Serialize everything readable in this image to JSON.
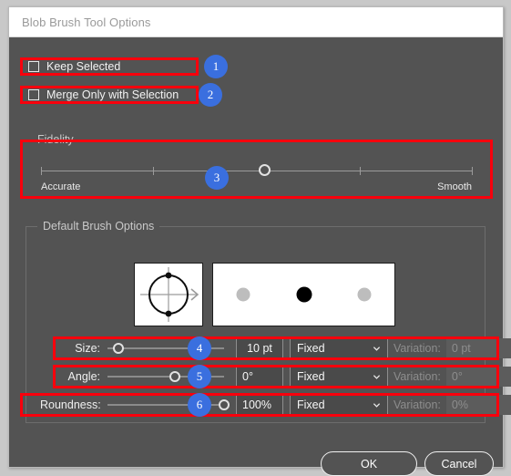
{
  "window": {
    "title": "Blob Brush Tool Options",
    "accent_blue": "#3a6fdf",
    "annotation_red": "#f8000c",
    "body_bg": "#535353",
    "titlebar_bg": "#ffffff"
  },
  "checkboxes": [
    {
      "label": "Keep Selected",
      "checked": false,
      "badge": "1"
    },
    {
      "label": "Merge Only with Selection",
      "checked": false,
      "badge": "2"
    }
  ],
  "fidelity": {
    "title": "Fidelity",
    "left_label": "Accurate",
    "right_label": "Smooth",
    "badge": "3",
    "value_percent": 52,
    "ticks_percent": [
      0,
      26,
      52,
      74,
      100
    ]
  },
  "default_brush": {
    "title": "Default Brush Options",
    "shape_editor": {
      "name": "brush-shape-editor",
      "dots": 2
    },
    "stroke_preview": {
      "name": "brush-stroke-preview",
      "dots": [
        {
          "color": "#bdbdbd"
        },
        {
          "color": "#000000"
        },
        {
          "color": "#bdbdbd"
        }
      ]
    },
    "rows": [
      {
        "label": "Size:",
        "badge": "4",
        "slider_percent": 9,
        "value": "10 pt",
        "dropdown": "Fixed",
        "variation_label": "Variation:",
        "variation_value": "0 pt",
        "disabled": true
      },
      {
        "label": "Angle:",
        "badge": "5",
        "slider_percent": 58,
        "value": "0°",
        "dropdown": "Fixed",
        "variation_label": "Variation:",
        "variation_value": "0°",
        "disabled": true
      },
      {
        "label": "Roundness:",
        "badge": "6",
        "slider_percent": 100,
        "value": "100%",
        "dropdown": "Fixed",
        "variation_label": "Variation:",
        "variation_value": "0%",
        "disabled": true
      }
    ]
  },
  "footer": {
    "ok_label": "OK",
    "cancel_label": "Cancel"
  }
}
